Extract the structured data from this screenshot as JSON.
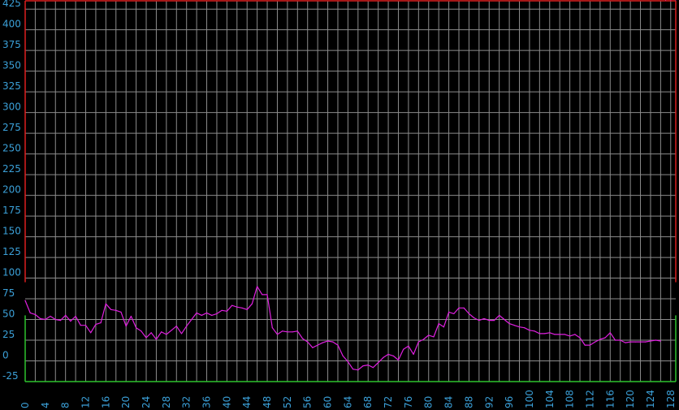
{
  "colors": {
    "background": "#000000",
    "grid": "#8c8c8c",
    "line": "#e020e0",
    "zone_high": "#dd1f1f",
    "zone_low": "#2ec22e",
    "tick_text": "#3ba0d8"
  },
  "chart_data": {
    "type": "line",
    "xlim": [
      0,
      129
    ],
    "ylim": [
      -25,
      435
    ],
    "grid": true,
    "y_ticks": [
      -25,
      0,
      25,
      50,
      75,
      100,
      125,
      150,
      175,
      200,
      225,
      250,
      275,
      300,
      325,
      350,
      375,
      400,
      425
    ],
    "x_ticks": [
      0,
      4,
      8,
      12,
      16,
      20,
      24,
      28,
      32,
      36,
      40,
      44,
      48,
      52,
      56,
      60,
      64,
      68,
      72,
      76,
      80,
      84,
      88,
      92,
      96,
      100,
      104,
      108,
      112,
      116,
      120,
      124,
      128
    ],
    "y_tick_labels": [
      "-25",
      "0",
      "25",
      "50",
      "75",
      "100",
      "125",
      "150",
      "175",
      "200",
      "225",
      "250",
      "275",
      "300",
      "325",
      "350",
      "375",
      "400",
      "425"
    ],
    "x_tick_labels": [
      "0",
      "4",
      "8",
      "12",
      "16",
      "20",
      "24",
      "28",
      "32",
      "36",
      "40",
      "44",
      "48",
      "52",
      "56",
      "60",
      "64",
      "68",
      "72",
      "76",
      "80",
      "84",
      "88",
      "92",
      "96",
      "100",
      "104",
      "108",
      "112",
      "116",
      "120",
      "124",
      "128"
    ],
    "band_high": [
      95,
      435
    ],
    "band_low": [
      -25,
      55
    ],
    "x": [
      0,
      1,
      2,
      3,
      4,
      5,
      6,
      7,
      8,
      9,
      10,
      11,
      12,
      13,
      14,
      15,
      16,
      17,
      18,
      19,
      20,
      21,
      22,
      23,
      24,
      25,
      26,
      27,
      28,
      29,
      30,
      31,
      32,
      33,
      34,
      35,
      36,
      37,
      38,
      39,
      40,
      41,
      42,
      43,
      44,
      45,
      46,
      47,
      48,
      49,
      50,
      51,
      52,
      53,
      54,
      55,
      56,
      57,
      58,
      59,
      60,
      61,
      62,
      63,
      64,
      65,
      66,
      67,
      68,
      69,
      70,
      71,
      72,
      73,
      74,
      75,
      76,
      77,
      78,
      79,
      80,
      81,
      82,
      83,
      84,
      85,
      86,
      87,
      88,
      89,
      90,
      91,
      92,
      93,
      94,
      95,
      96,
      97,
      98,
      99,
      100,
      101,
      102,
      103,
      104,
      105,
      106,
      107,
      108,
      109,
      110,
      111,
      112,
      113,
      114,
      115,
      116,
      117,
      118,
      119,
      120,
      121,
      122,
      123,
      124,
      125,
      126,
      127,
      128,
      129
    ],
    "y": [
      73,
      58,
      56,
      51,
      50,
      54,
      50,
      49,
      55,
      48,
      54,
      43,
      43,
      34,
      44,
      46,
      69,
      62,
      61,
      59,
      42,
      54,
      40,
      36,
      28,
      34,
      26,
      35,
      32,
      37,
      42,
      33,
      42,
      50,
      58,
      55,
      58,
      55,
      57,
      61,
      60,
      67,
      65,
      64,
      62,
      69,
      90,
      80,
      80,
      40,
      32,
      36,
      35,
      35,
      36,
      27,
      23,
      16,
      19,
      22,
      24,
      23,
      19,
      6,
      -1,
      -10,
      -11,
      -6,
      -5,
      -8,
      -2,
      4,
      8,
      6,
      1,
      14,
      18,
      8,
      23,
      26,
      31,
      29,
      45,
      41,
      59,
      57,
      64,
      64,
      57,
      52,
      49,
      51,
      49,
      49,
      55,
      50,
      45,
      43,
      41,
      40,
      37,
      36,
      33,
      33,
      34,
      32,
      32,
      32,
      30,
      32,
      28,
      19,
      19,
      23,
      26,
      28,
      34,
      25,
      25,
      22,
      23,
      23,
      23,
      23,
      24,
      25,
      24
    ],
    "title": "",
    "xlabel": "",
    "ylabel": ""
  }
}
